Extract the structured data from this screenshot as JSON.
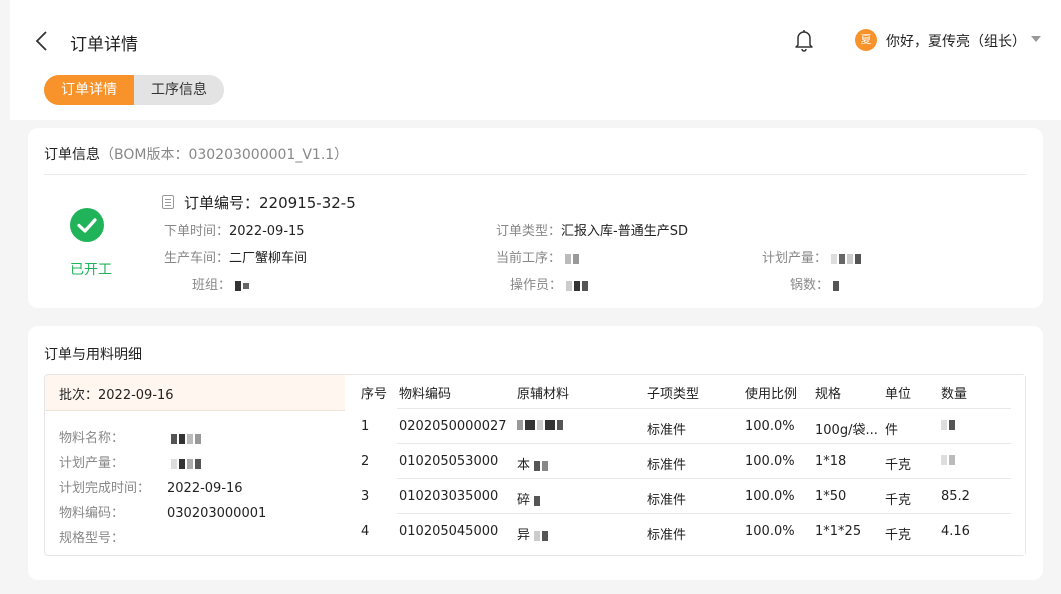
{
  "header": {
    "back_icon": "chevron-left-icon",
    "title": "订单详情",
    "bell_icon": "bell-icon",
    "avatar_char": "夏",
    "greeting": "你好，夏传亮（组长）",
    "caret_icon": "caret-down-icon"
  },
  "tabs": [
    {
      "label": "订单详情",
      "active": true
    },
    {
      "label": "工序信息",
      "active": false
    }
  ],
  "order_info": {
    "heading": "订单信息",
    "bom_label": "（BOM版本：030203000001_V1.1）",
    "status_label": "已开工",
    "order_no_label": "订单编号：",
    "order_no": "220915-32-5",
    "fields": {
      "order_time": {
        "label": "下单时间：",
        "value": "2022-09-15"
      },
      "workshop": {
        "label": "生产车间：",
        "value": "二厂蟹柳车间"
      },
      "team": {
        "label": "班组：",
        "value": ""
      },
      "order_type": {
        "label": "订单类型：",
        "value": "汇报入库-普通生产SD"
      },
      "current_process": {
        "label": "当前工序：",
        "value": ""
      },
      "operator": {
        "label": "操作员：",
        "value": ""
      },
      "planned_output": {
        "label": "计划产量：",
        "value": ""
      },
      "pot_count": {
        "label": "锅数：",
        "value": ""
      }
    }
  },
  "materials": {
    "heading": "订单与用料明细",
    "batch_label": "批次：2022-09-16",
    "left": [
      {
        "label": "物料名称：",
        "value": ""
      },
      {
        "label": "计划产量：",
        "value": ""
      },
      {
        "label": "计划完成时间：",
        "value": "2022-09-16"
      },
      {
        "label": "物料编码：",
        "value": "030203000001"
      },
      {
        "label": "规格型号：",
        "value": ""
      }
    ],
    "columns": [
      "序号",
      "物料编码",
      "原辅材料",
      "子项类型",
      "使用比例",
      "规格",
      "单位",
      "数量"
    ],
    "rows": [
      {
        "no": "1",
        "code": "0202050000027",
        "material": "",
        "type": "标准件",
        "ratio": "100.0%",
        "spec": "100g/袋...",
        "unit": "件",
        "qty": ""
      },
      {
        "no": "2",
        "code": "010205053000",
        "material": "本",
        "type": "标准件",
        "ratio": "100.0%",
        "spec": "1*18",
        "unit": "千克",
        "qty": ""
      },
      {
        "no": "3",
        "code": "010203035000",
        "material": "碎",
        "type": "标准件",
        "ratio": "100.0%",
        "spec": "1*50",
        "unit": "千克",
        "qty": "85.2"
      },
      {
        "no": "4",
        "code": "010205045000",
        "material": "异",
        "type": "标准件",
        "ratio": "100.0%",
        "spec": "1*1*25",
        "unit": "千克",
        "qty": "4.16"
      }
    ]
  },
  "colors": {
    "accent": "#f7932a",
    "success": "#21b35a",
    "background": "#f5f5f5"
  }
}
